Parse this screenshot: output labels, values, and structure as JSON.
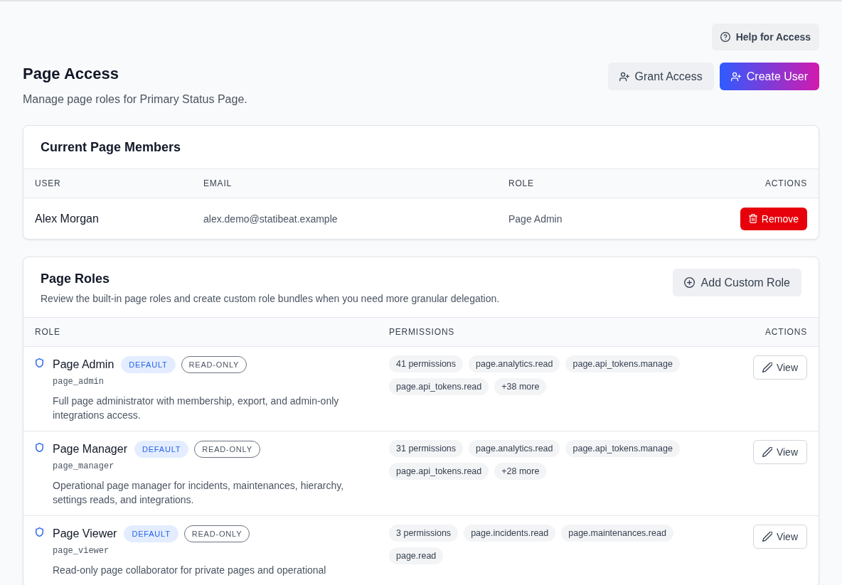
{
  "header": {
    "help_button": "Help for Access",
    "title": "Page Access",
    "subtitle": "Manage page roles for Primary Status Page.",
    "actions": [
      {
        "label": "Grant Access",
        "kind": "secondary"
      },
      {
        "label": "Create User",
        "kind": "primary"
      }
    ]
  },
  "members": {
    "title": "Current Page Members",
    "columns": [
      "USER",
      "EMAIL",
      "ROLE",
      "ACTIONS"
    ],
    "rows": [
      {
        "user": "Alex Morgan",
        "email": "alex.demo@statibeat.example",
        "role": "Page Admin",
        "action": "Remove"
      }
    ]
  },
  "roles": {
    "title": "Page Roles",
    "description": "Review the built-in page roles and create custom role bundles when you need more granular delegation.",
    "add_button": "Add Custom Role",
    "columns": [
      "ROLE",
      "PERMISSIONS",
      "ACTIONS"
    ],
    "rows": [
      {
        "name": "Page Admin",
        "badges": [
          {
            "label": "DEFAULT",
            "kind": "default"
          },
          {
            "label": "READ-ONLY",
            "kind": "readonly"
          }
        ],
        "key": "page_admin",
        "description": "Full page administrator with membership, export, and admin-only integrations access.",
        "permissions": [
          "41 permissions",
          "page.analytics.read",
          "page.api_tokens.manage",
          "page.api_tokens.read",
          "+38 more"
        ],
        "action": "View"
      },
      {
        "name": "Page Manager",
        "badges": [
          {
            "label": "DEFAULT",
            "kind": "default"
          },
          {
            "label": "READ-ONLY",
            "kind": "readonly"
          }
        ],
        "key": "page_manager",
        "description": "Operational page manager for incidents, maintenances, hierarchy, settings reads, and integrations.",
        "permissions": [
          "31 permissions",
          "page.analytics.read",
          "page.api_tokens.manage",
          "page.api_tokens.read",
          "+28 more"
        ],
        "action": "View"
      },
      {
        "name": "Page Viewer",
        "badges": [
          {
            "label": "DEFAULT",
            "kind": "default"
          },
          {
            "label": "READ-ONLY",
            "kind": "readonly"
          }
        ],
        "key": "page_viewer",
        "description": "Read-only page collaborator for private pages and operational",
        "permissions": [
          "3 permissions",
          "page.incidents.read",
          "page.maintenances.read",
          "page.read"
        ],
        "action": "View"
      }
    ]
  }
}
